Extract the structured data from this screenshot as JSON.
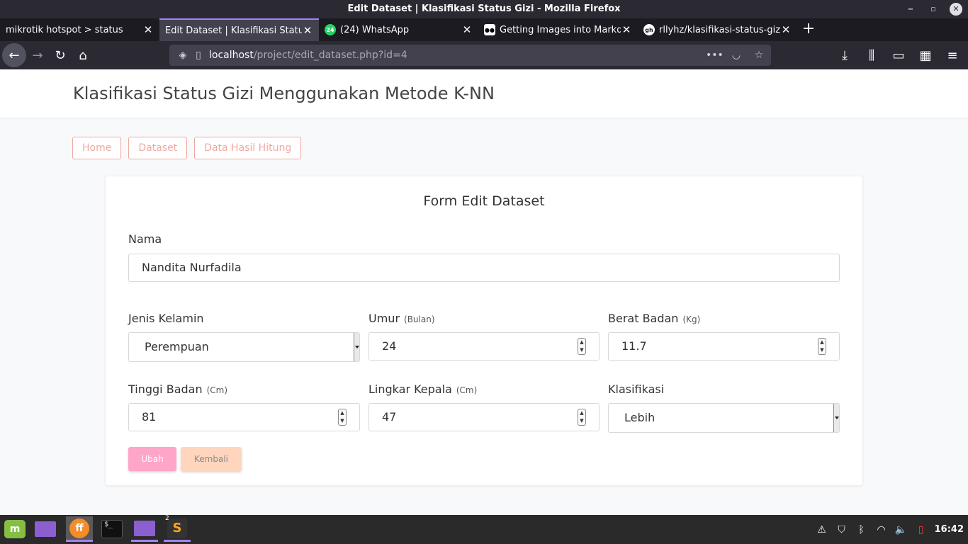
{
  "window": {
    "title": "Edit Dataset | Klasifikasi Status Gizi - Mozilla Firefox",
    "minimize": "‒",
    "maximize": "▫",
    "close": "✕"
  },
  "tabs": [
    {
      "label": "mikrotik hotspot > status",
      "active": false
    },
    {
      "label": "Edit Dataset | Klasifikasi Status",
      "active": true
    },
    {
      "label": "(24) WhatsApp",
      "favicon": "24",
      "active": false
    },
    {
      "label": "Getting Images into Markd",
      "favicon": "●●",
      "active": false
    },
    {
      "label": "rllyhz/klasifikasi-status-gizi",
      "favicon": "gh",
      "active": false
    }
  ],
  "tab_close": "✕",
  "new_tab": "+",
  "url": {
    "host": "localhost",
    "path": "/project/edit_dataset.php?id=4"
  },
  "icons": {
    "back": "←",
    "forward": "→",
    "reload": "↻",
    "home": "⌂",
    "shield": "◈",
    "page": "▯",
    "more": "•••",
    "pocket": "◡",
    "star": "☆",
    "download": "⤓",
    "library": "⫼",
    "sidebar": "▭",
    "extensions": "▦",
    "menu": "≡"
  },
  "page": {
    "site_title": "Klasifikasi Status Gizi Menggunakan Metode K-NN",
    "nav": [
      "Home",
      "Dataset",
      "Data Hasil Hitung"
    ],
    "form_title": "Form Edit Dataset",
    "fields": {
      "nama": {
        "label": "Nama",
        "value": "Nandita Nurfadila"
      },
      "jenis_kelamin": {
        "label": "Jenis Kelamin",
        "value": "Perempuan"
      },
      "umur": {
        "label": "Umur",
        "unit": "(Bulan)",
        "value": "24"
      },
      "berat_badan": {
        "label": "Berat Badan",
        "unit": "(Kg)",
        "value": "11.7"
      },
      "tinggi_badan": {
        "label": "Tinggi Badan",
        "unit": "(Cm)",
        "value": "81"
      },
      "lingkar_kepala": {
        "label": "Lingkar Kepala",
        "unit": "(Cm)",
        "value": "47"
      },
      "klasifikasi": {
        "label": "Klasifikasi",
        "value": "Lebih"
      }
    },
    "buttons": {
      "ubah": "Ubah",
      "kembali": "Kembali"
    }
  },
  "spinner": {
    "up": "▲",
    "down": "▼"
  },
  "taskbar": {
    "mint": "m",
    "firefox": "ff",
    "terminal": "$_",
    "sublime": "S",
    "sublime_badge": "2",
    "tray": {
      "warning": "⚠",
      "shield": "⛉",
      "bluetooth": "ᛒ",
      "wifi": "◠",
      "volume": "🔈",
      "battery": "▯"
    },
    "clock": "16:42"
  },
  "colors": {
    "accent": "#a580ff",
    "nav_link": "#f0a9a1",
    "btn_ubah": "#ffa5c8",
    "btn_kembali": "#ffd6bd"
  }
}
